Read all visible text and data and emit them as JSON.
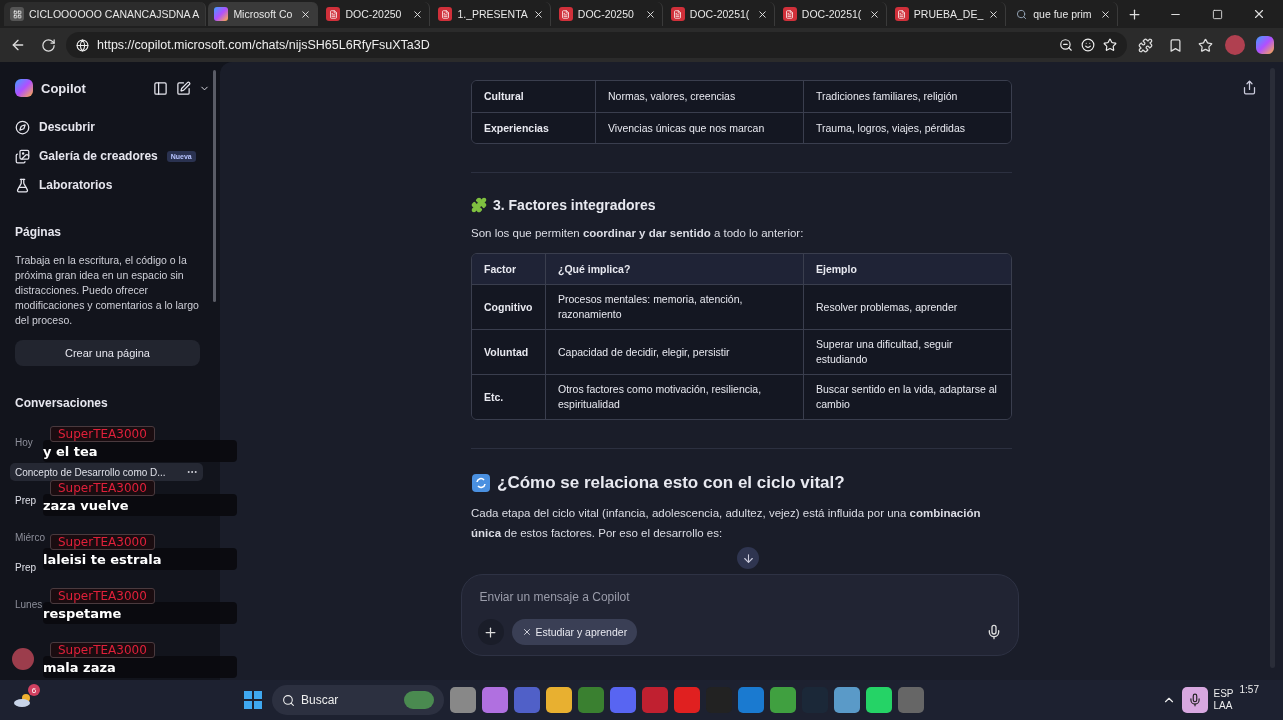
{
  "browser": {
    "tabs": [
      {
        "label": "CICLOOOOOO CANANCAJSDNA A",
        "kind": "group",
        "selected": false
      },
      {
        "label": "Microsoft Co",
        "kind": "copilot",
        "selected": true
      },
      {
        "label": "DOC-20250",
        "kind": "pdf",
        "selected": false
      },
      {
        "label": "1._PRESENTA",
        "kind": "pdf",
        "selected": false
      },
      {
        "label": "DOC-20250",
        "kind": "pdf",
        "selected": false
      },
      {
        "label": "DOC-20251(",
        "kind": "pdf",
        "selected": false
      },
      {
        "label": "DOC-20251(",
        "kind": "pdf",
        "selected": false
      },
      {
        "label": "PRUEBA_DE_",
        "kind": "pdf",
        "selected": false
      },
      {
        "label": "que fue prim",
        "kind": "search",
        "selected": false
      }
    ],
    "url": "https://copilot.microsoft.com/chats/nijsSH65L6RfyFsuXTa3D"
  },
  "sidebar": {
    "title": "Copilot",
    "nav": [
      {
        "label": "Descubrir",
        "kind": "discover"
      },
      {
        "label": "Galería de creadores",
        "kind": "gallery",
        "badge": "Nueva"
      },
      {
        "label": "Laboratorios",
        "kind": "labs"
      }
    ],
    "pages": {
      "heading": "Páginas",
      "description": "Trabaja en la escritura, el código o la próxima gran idea en un espacio sin distracciones. Puedo ofrecer modificaciones y comentarios a lo largo del proceso.",
      "button": "Crear una página"
    },
    "conversations": {
      "heading": "Conversaciones",
      "groups": [
        {
          "label": "Hoy",
          "items": [
            {
              "title": "Concepto de Desarrollo como D...",
              "selected": true
            },
            {
              "title": "Prep",
              "selected": false
            }
          ]
        },
        {
          "label": "Miérco",
          "items": [
            {
              "title": "Prep",
              "selected": false
            }
          ]
        },
        {
          "label": "Lunes"
        }
      ]
    }
  },
  "main": {
    "top_table": {
      "rows": [
        [
          "Cultural",
          "Normas, valores, creencias",
          "Tradiciones familiares, religión"
        ],
        [
          "Experiencias",
          "Vivencias únicas que nos marcan",
          "Trauma, logros, viajes, pérdidas"
        ]
      ]
    },
    "sections": [
      {
        "heading": "3. Factores integradores",
        "kind": "puzzle",
        "intro": "Son los que permiten **coordinar y dar sentido** a todo lo anterior:",
        "table": {
          "columns": [
            "Factor",
            "¿Qué implica?",
            "Ejemplo"
          ],
          "rows": [
            [
              "Cognitivo",
              "Procesos mentales: memoria, atención, razonamiento",
              "Resolver problemas, aprender"
            ],
            [
              "Voluntad",
              "Capacidad de decidir, elegir, persistir",
              "Superar una dificultad, seguir estudiando"
            ],
            [
              "Etc.",
              "Otros factores como motivación, resiliencia, espiritualidad",
              "Buscar sentido en la vida, adaptarse al cambio"
            ]
          ]
        }
      },
      {
        "heading": "¿Cómo se relaciona esto con el ciclo vital?",
        "kind": "cycle",
        "intro": "Cada etapa del ciclo vital (infancia, adolescencia, adultez, vejez) está influida por una **combinación única** de estos factores. Por eso el desarrollo es:"
      }
    ],
    "composer": {
      "placeholder": "Enviar un mensaje a Copilot",
      "chip": "Estudiar y aprender"
    }
  },
  "stream_chat": [
    {
      "user": "SuperTEA3000",
      "text": "y el tea"
    },
    {
      "user": "SuperTEA3000",
      "text": "zaza vuelve"
    },
    {
      "user": "SuperTEA3000",
      "text": "laleisi te estrala"
    },
    {
      "user": "SuperTEA3000",
      "text": "respetame"
    },
    {
      "user": "SuperTEA3000",
      "text": "mala zaza"
    }
  ],
  "taskbar": {
    "weather_badge": "6",
    "search": "Buscar",
    "language": "ESP",
    "layout": "LAA",
    "time": "1:57"
  }
}
